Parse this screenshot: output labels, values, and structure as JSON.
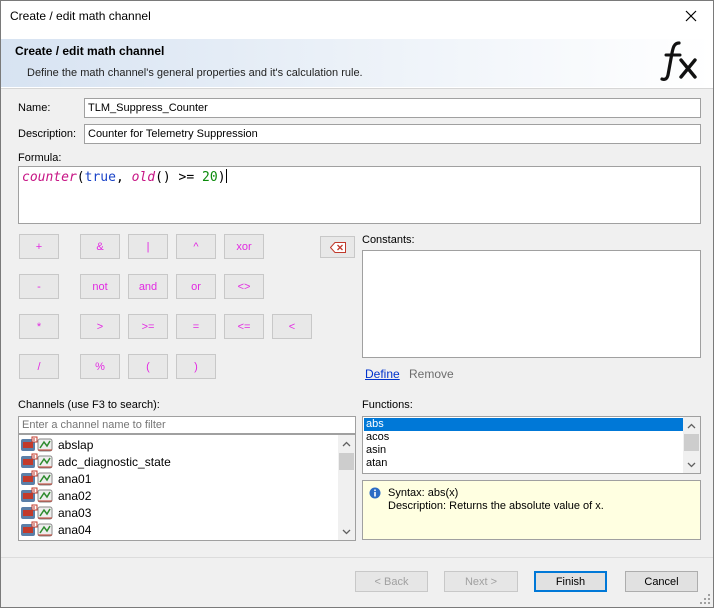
{
  "window": {
    "title": "Create / edit math channel"
  },
  "header": {
    "title": "Create / edit math channel",
    "description": "Define the math channel's general properties and it's calculation rule."
  },
  "form": {
    "name_label": "Name:",
    "name_value": "TLM_Suppress_Counter",
    "description_label": "Description:",
    "description_value": "Counter for Telemetry Suppression",
    "formula_label": "Formula:"
  },
  "formula": {
    "fn1": "counter",
    "p1": "(",
    "kw": "true",
    "p2": ", ",
    "fn2": "old",
    "p3": "() >= ",
    "num": "20",
    "p4": ")"
  },
  "operators": [
    "+",
    "&",
    "|",
    "^",
    "xor",
    "-",
    "not",
    "and",
    "or",
    "<>",
    "*",
    ">",
    ">=",
    "=",
    "<=",
    "<",
    "/",
    "%",
    "(",
    ")"
  ],
  "constants": {
    "label": "Constants:",
    "define_label": "Define",
    "remove_label": "Remove"
  },
  "channels": {
    "label": "Channels (use F3 to search):",
    "filter_placeholder": "Enter a channel name to filter",
    "items": [
      "abslap",
      "adc_diagnostic_state",
      "ana01",
      "ana02",
      "ana03",
      "ana04"
    ]
  },
  "functions": {
    "label": "Functions:",
    "items": [
      "abs",
      "acos",
      "asin",
      "atan"
    ],
    "selected": "abs"
  },
  "syntax": {
    "line1": "Syntax: abs(x)",
    "line2": "Description: Returns the absolute value of x."
  },
  "buttons": {
    "back": "< Back",
    "next": "Next >",
    "finish": "Finish",
    "cancel": "Cancel"
  },
  "colors": {
    "operator_text": "#e22ae2",
    "selection": "#0078d7",
    "syntax_background": "#ffffe1",
    "link": "#0033cc"
  }
}
